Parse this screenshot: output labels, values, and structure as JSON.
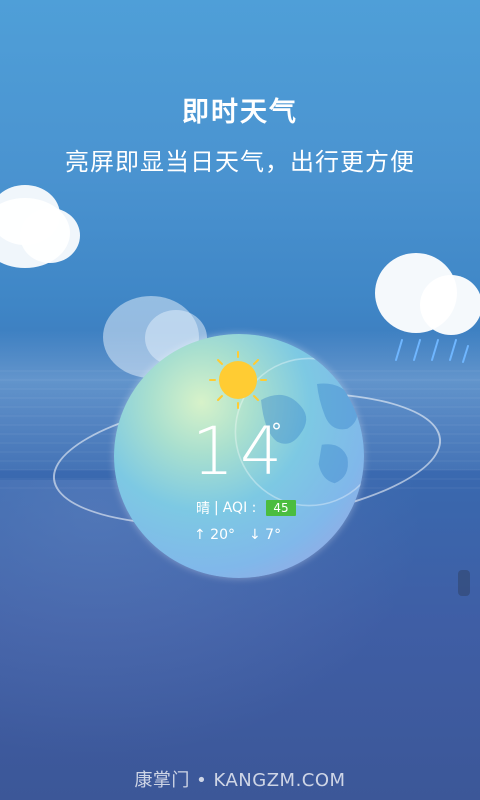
{
  "promo": {
    "headline": "即时天气",
    "subline": "亮屏即显当日天气，出行更方便"
  },
  "weather": {
    "temperature": "14",
    "degree_symbol": "°",
    "condition": "晴",
    "separator": "|",
    "aqi_label": "AQI :",
    "aqi_value": "45",
    "high": "↑ 20°",
    "low": "↓ 7°"
  },
  "icons": {
    "sun": "sun-icon",
    "rain_cloud": "rain-cloud-icon",
    "globe": "globe-icon"
  },
  "colors": {
    "aqi_good": "#4bbd3f"
  },
  "watermark": {
    "text": "康掌门 • KANGZM.COM"
  }
}
